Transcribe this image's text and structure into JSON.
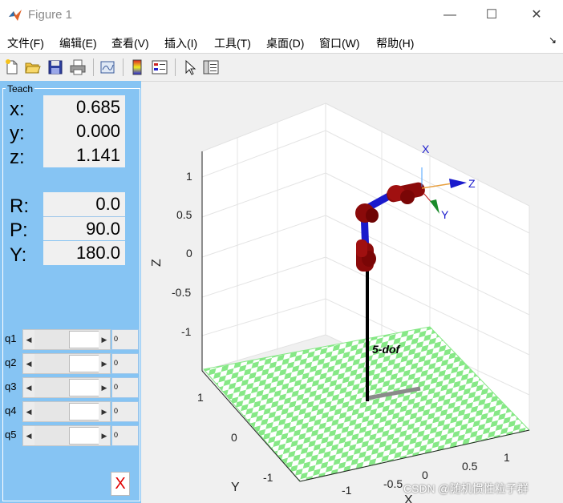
{
  "window": {
    "title": "Figure 1",
    "minimize_glyph": "—",
    "maximize_glyph": "☐",
    "close_glyph": "✕"
  },
  "menu": {
    "items": [
      "文件(F)",
      "编辑(E)",
      "查看(V)",
      "插入(I)",
      "工具(T)",
      "桌面(D)",
      "窗口(W)",
      "帮助(H)"
    ],
    "dock_glyph": "↘"
  },
  "toolbar": {
    "icons": [
      "new-figure-icon",
      "open-file-icon",
      "save-icon",
      "print-icon",
      "link-plot-icon",
      "colorbar-icon",
      "legend-icon",
      "pointer-icon",
      "property-inspector-icon"
    ]
  },
  "teach": {
    "title": "Teach",
    "x_label": "x:",
    "x_value": "0.685",
    "y_label": "y:",
    "y_value": "0.000",
    "z_label": "z:",
    "z_value": "1.141",
    "r_label": "R:",
    "r_value": "0.0",
    "p_label": "P:",
    "p_value": "90.0",
    "yaw_label": "Y:",
    "yaw_value": "180.0",
    "joints": [
      {
        "label": "q1",
        "value": "0"
      },
      {
        "label": "q2",
        "value": "0"
      },
      {
        "label": "q3",
        "value": "0"
      },
      {
        "label": "q4",
        "value": "0"
      },
      {
        "label": "q5",
        "value": "0"
      }
    ],
    "close_label": "X"
  },
  "plot": {
    "z_axis_label": "Z",
    "y_axis_label": "Y",
    "x_axis_label": "X",
    "z_ticks": [
      "1",
      "0.5",
      "0",
      "-0.5",
      "-1"
    ],
    "y_ticks": [
      "1",
      "0",
      "-1"
    ],
    "x_ticks": [
      "-1",
      "-0.5",
      "0",
      "0.5",
      "1"
    ],
    "robot_name": "5-dof",
    "frame_x": "X",
    "frame_y": "Y",
    "frame_z": "Z",
    "colors": {
      "link": "#1010c8",
      "joint": "#8b0000",
      "floor_a": "#86e886",
      "floor_b": "#ffffff"
    }
  },
  "watermark": "CSDN @随机惯性粒子群"
}
